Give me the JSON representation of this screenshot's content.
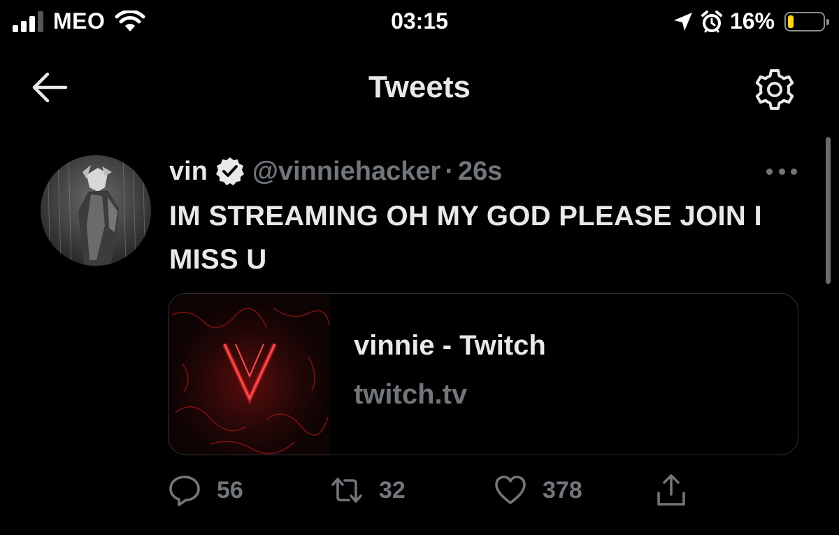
{
  "status_bar": {
    "carrier": "MEO",
    "time": "03:15",
    "battery_percent": "16%",
    "battery_level": 0.16,
    "battery_color": "#ffd60a",
    "icons": [
      "signal-icon",
      "wifi-icon",
      "location-arrow-icon",
      "alarm-icon",
      "battery-icon"
    ]
  },
  "header": {
    "title": "Tweets",
    "back_icon": "arrow-left-icon",
    "settings_icon": "gear-icon"
  },
  "tweet": {
    "display_name": "vin",
    "verified": true,
    "handle": "@vinniehacker",
    "separator": "·",
    "timestamp": "26s",
    "text": "IM STREAMING OH MY GOD PLEASE JOIN I MISS U",
    "more_icon": "more-horizontal-icon",
    "link_card": {
      "title": "vinnie - Twitch",
      "domain": "twitch.tv"
    },
    "actions": {
      "reply_count": "56",
      "retweet_count": "32",
      "like_count": "378"
    }
  },
  "colors": {
    "background": "#000000",
    "primary_text": "#e7e9ea",
    "secondary_text": "#71767b",
    "border": "#2f3336",
    "twitch_red": "#ff2a2a"
  }
}
